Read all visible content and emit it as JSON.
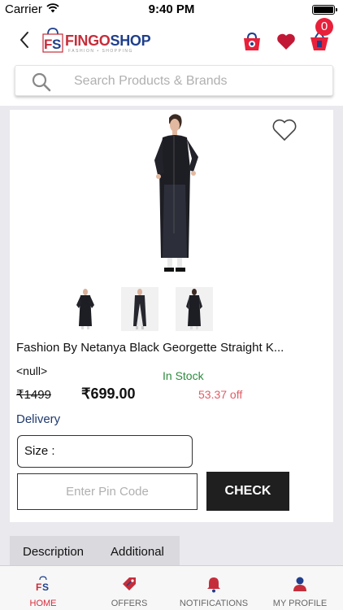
{
  "status_bar": {
    "carrier": "Carrier",
    "time": "9:40 PM"
  },
  "header": {
    "logo_fingo": "FINGO",
    "logo_shop": "SHOP",
    "logo_tagline": "FASHION • SHOPPING",
    "cart_count": "0"
  },
  "search": {
    "placeholder": "Search Products & Brands"
  },
  "product": {
    "title": "Fashion By Netanya Black Georgette Straight K...",
    "brand": "<null>",
    "stock_status": "In Stock",
    "mrp": "₹1499",
    "price": "₹699.00",
    "discount": "53.37 off",
    "delivery_label": "Delivery",
    "size_label": "Size :",
    "pincode_placeholder": "Enter Pin Code",
    "check_label": "CHECK"
  },
  "info_tabs": [
    "Description",
    "Additional"
  ],
  "tabbar": {
    "items": [
      {
        "label": "HOME",
        "icon": "fs-logo-icon",
        "active": true
      },
      {
        "label": "OFFERS",
        "icon": "offer-tag-icon",
        "active": false
      },
      {
        "label": "NOTIFICATIONS",
        "icon": "bell-icon",
        "active": false
      },
      {
        "label": "MY PROFILE",
        "icon": "user-icon",
        "active": false
      }
    ]
  },
  "colors": {
    "brand_red": "#c62d3a",
    "brand_blue": "#1f3f8c",
    "in_stock": "#2e8b3e",
    "discount": "#e05c66",
    "active_tab": "#d62b3c"
  }
}
